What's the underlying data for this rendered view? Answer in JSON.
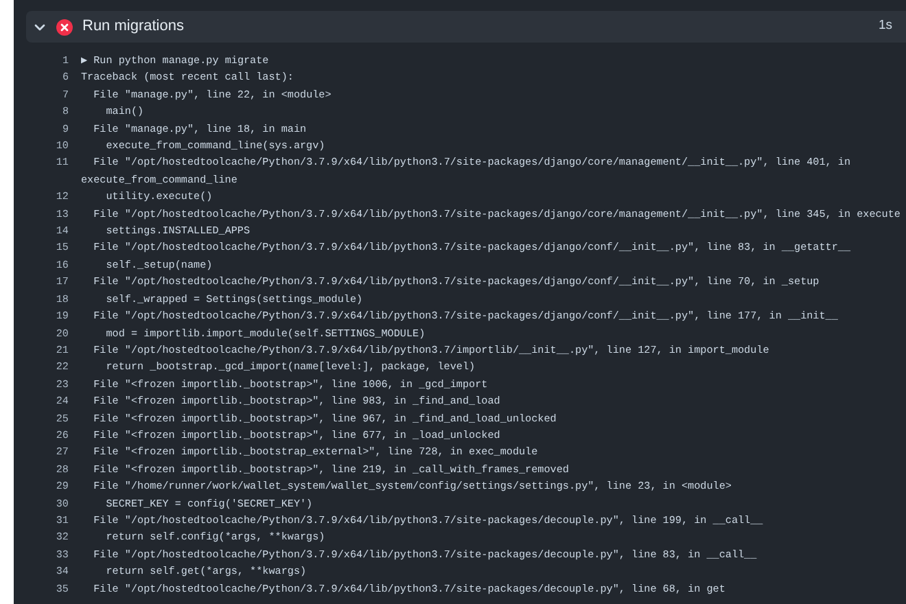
{
  "step": {
    "title": "Run migrations",
    "duration": "1s",
    "failed": true,
    "expanded": true
  },
  "log_lines": [
    {
      "number": "1",
      "text": "▶ Run python manage.py migrate"
    },
    {
      "number": "6",
      "text": "Traceback (most recent call last):"
    },
    {
      "number": "7",
      "text": "  File \"manage.py\", line 22, in <module>"
    },
    {
      "number": "8",
      "text": "    main()"
    },
    {
      "number": "9",
      "text": "  File \"manage.py\", line 18, in main"
    },
    {
      "number": "10",
      "text": "    execute_from_command_line(sys.argv)"
    },
    {
      "number": "11",
      "text": "  File \"/opt/hostedtoolcache/Python/3.7.9/x64/lib/python3.7/site-packages/django/core/management/__init__.py\", line 401, in execute_from_command_line"
    },
    {
      "number": "12",
      "text": "    utility.execute()"
    },
    {
      "number": "13",
      "text": "  File \"/opt/hostedtoolcache/Python/3.7.9/x64/lib/python3.7/site-packages/django/core/management/__init__.py\", line 345, in execute"
    },
    {
      "number": "14",
      "text": "    settings.INSTALLED_APPS"
    },
    {
      "number": "15",
      "text": "  File \"/opt/hostedtoolcache/Python/3.7.9/x64/lib/python3.7/site-packages/django/conf/__init__.py\", line 83, in __getattr__"
    },
    {
      "number": "16",
      "text": "    self._setup(name)"
    },
    {
      "number": "17",
      "text": "  File \"/opt/hostedtoolcache/Python/3.7.9/x64/lib/python3.7/site-packages/django/conf/__init__.py\", line 70, in _setup"
    },
    {
      "number": "18",
      "text": "    self._wrapped = Settings(settings_module)"
    },
    {
      "number": "19",
      "text": "  File \"/opt/hostedtoolcache/Python/3.7.9/x64/lib/python3.7/site-packages/django/conf/__init__.py\", line 177, in __init__"
    },
    {
      "number": "20",
      "text": "    mod = importlib.import_module(self.SETTINGS_MODULE)"
    },
    {
      "number": "21",
      "text": "  File \"/opt/hostedtoolcache/Python/3.7.9/x64/lib/python3.7/importlib/__init__.py\", line 127, in import_module"
    },
    {
      "number": "22",
      "text": "    return _bootstrap._gcd_import(name[level:], package, level)"
    },
    {
      "number": "23",
      "text": "  File \"<frozen importlib._bootstrap>\", line 1006, in _gcd_import"
    },
    {
      "number": "24",
      "text": "  File \"<frozen importlib._bootstrap>\", line 983, in _find_and_load"
    },
    {
      "number": "25",
      "text": "  File \"<frozen importlib._bootstrap>\", line 967, in _find_and_load_unlocked"
    },
    {
      "number": "26",
      "text": "  File \"<frozen importlib._bootstrap>\", line 677, in _load_unlocked"
    },
    {
      "number": "27",
      "text": "  File \"<frozen importlib._bootstrap_external>\", line 728, in exec_module"
    },
    {
      "number": "28",
      "text": "  File \"<frozen importlib._bootstrap>\", line 219, in _call_with_frames_removed"
    },
    {
      "number": "29",
      "text": "  File \"/home/runner/work/wallet_system/wallet_system/config/settings/settings.py\", line 23, in <module>"
    },
    {
      "number": "30",
      "text": "    SECRET_KEY = config('SECRET_KEY')"
    },
    {
      "number": "31",
      "text": "  File \"/opt/hostedtoolcache/Python/3.7.9/x64/lib/python3.7/site-packages/decouple.py\", line 199, in __call__"
    },
    {
      "number": "32",
      "text": "    return self.config(*args, **kwargs)"
    },
    {
      "number": "33",
      "text": "  File \"/opt/hostedtoolcache/Python/3.7.9/x64/lib/python3.7/site-packages/decouple.py\", line 83, in __call__"
    },
    {
      "number": "34",
      "text": "    return self.get(*args, **kwargs)"
    },
    {
      "number": "35",
      "text": "  File \"/opt/hostedtoolcache/Python/3.7.9/x64/lib/python3.7/site-packages/decouple.py\", line 68, in get"
    }
  ]
}
